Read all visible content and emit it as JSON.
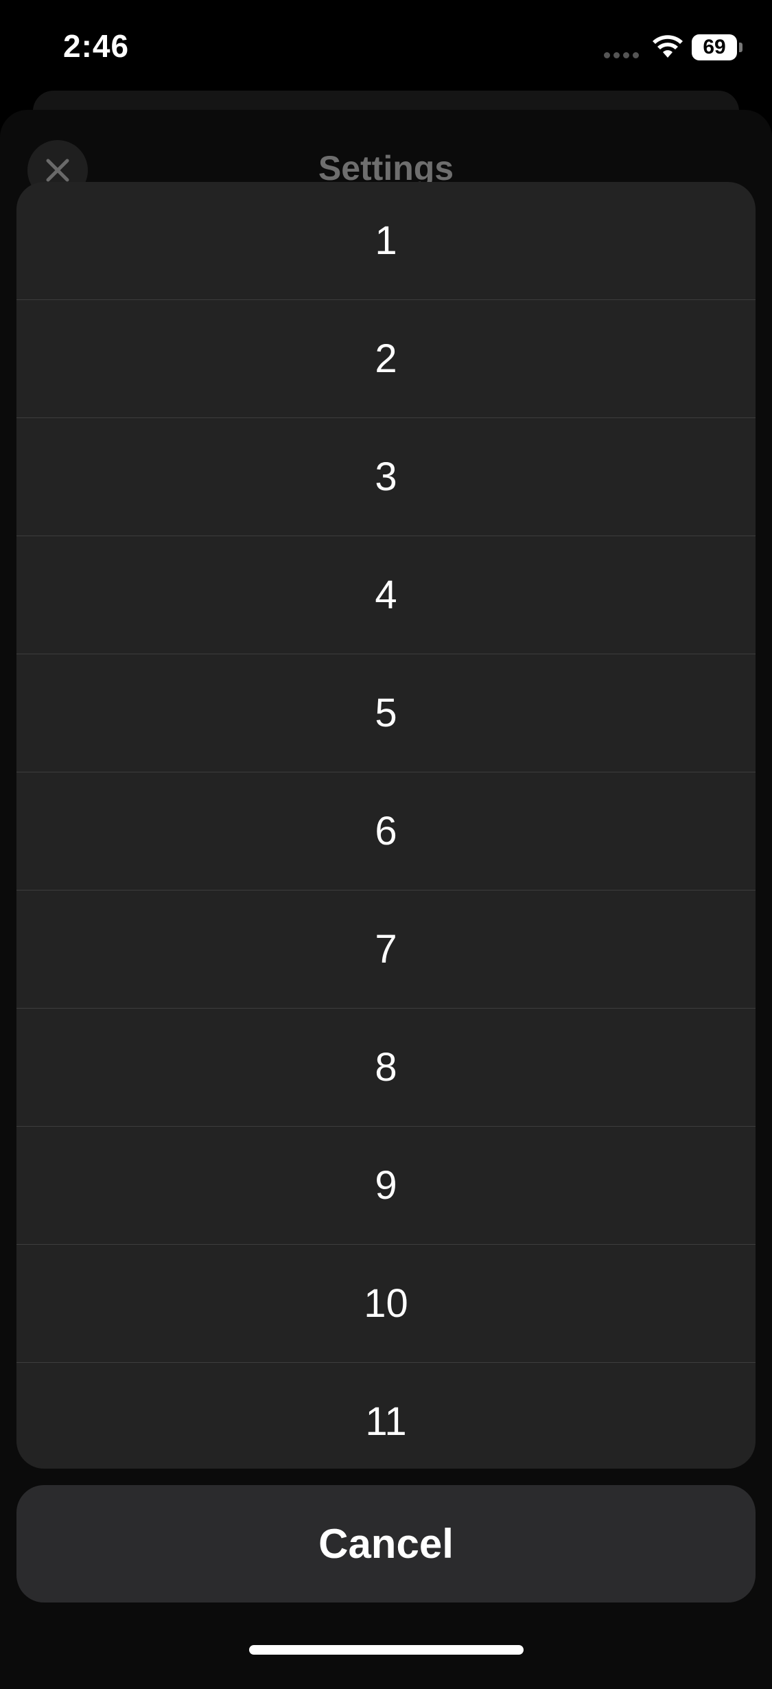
{
  "status_bar": {
    "time": "2:46",
    "battery": "69",
    "icons": [
      "cellular-signal-icon",
      "wifi-icon",
      "battery-icon"
    ]
  },
  "background_sheet": {
    "title": "Settings",
    "close_icon": "close-icon"
  },
  "action_sheet": {
    "options": [
      "1",
      "2",
      "3",
      "4",
      "5",
      "6",
      "7",
      "8",
      "9",
      "10",
      "11"
    ],
    "cancel_label": "Cancel"
  },
  "colors": {
    "background": "#000000",
    "sheet": "#232323",
    "cancel": "#2b2b2d",
    "text": "#ffffff",
    "dimmed_title": "#6e6e6e"
  }
}
